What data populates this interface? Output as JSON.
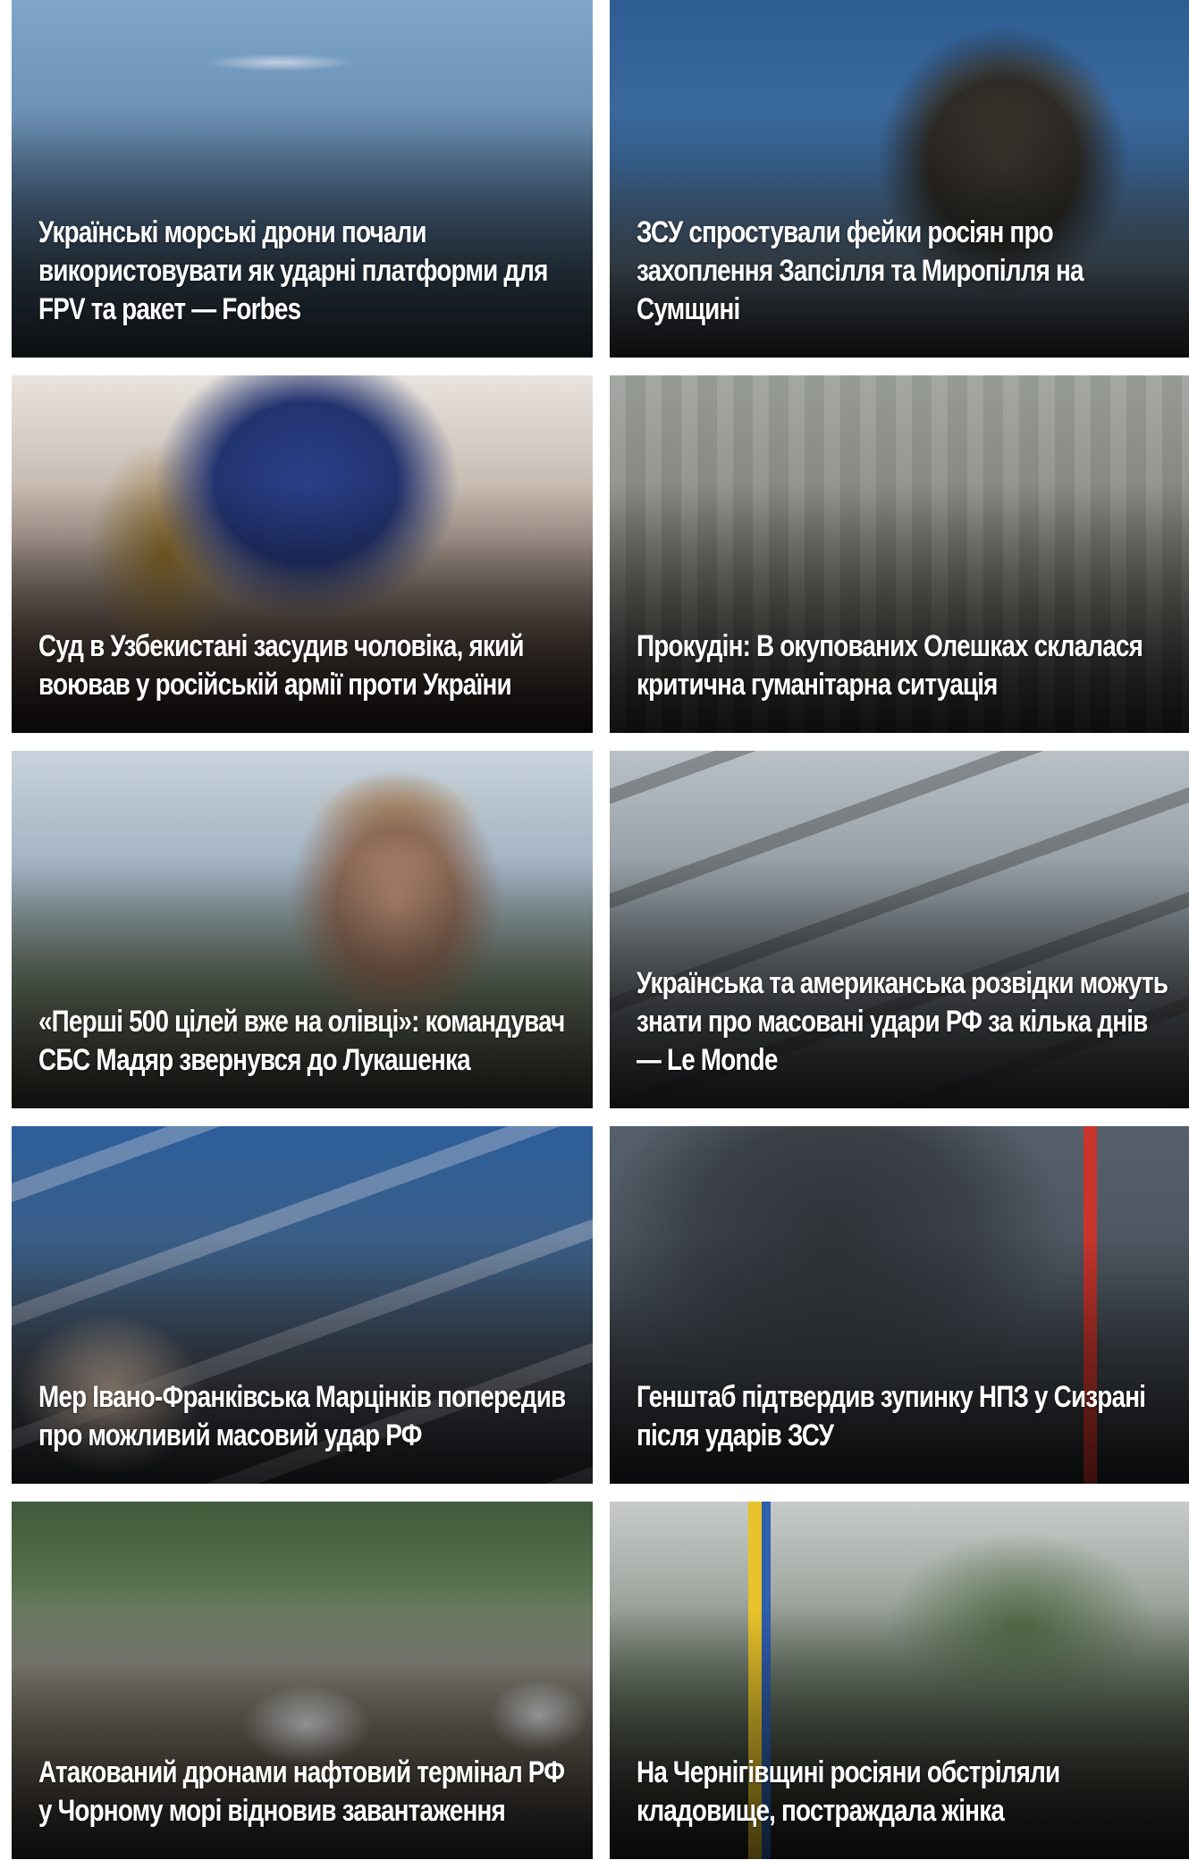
{
  "news_grid": {
    "cards": [
      {
        "title": "Українські морські дрони почали використовувати як ударні платформи для FPV та ракет — Forbes",
        "image": "naval-drone-missile-launch"
      },
      {
        "title": "ЗСУ спростували фейки росіян про захоплення Запсілля та Миропілля на Сумщині",
        "image": "soldier-with-ukrainian-flag"
      },
      {
        "title": "Суд в Узбекистані засудив чоловіка, який воював у російській армії проти України",
        "image": "court-scales-and-gavel"
      },
      {
        "title": "Прокудін: В окупованих Олешках склалася критична гуманітарна ситуація",
        "image": "aerial-town-view"
      },
      {
        "title": "«Перші 500 цілей вже на олівці»: командувач СБС Мадяр звернувся до Лукашенка",
        "image": "bearded-man-in-cap"
      },
      {
        "title": "Українська та американська розвідки можуть знати про масовані удари РФ за кілька днів — Le Monde",
        "image": "missiles-and-bombs"
      },
      {
        "title": "Мер Івано-Франківська Марцінків попередив про можливий масовий удар РФ",
        "image": "rocket-launch-missiles"
      },
      {
        "title": "Генштаб підтвердив зупинку НПЗ у Сизрані після ударів ЗСУ",
        "image": "refinery-smoke"
      },
      {
        "title": "Атакований дронами нафтовий термінал РФ у Чорному морі відновив завантаження",
        "image": "oil-terminal-tanks"
      },
      {
        "title": "На Чернігівщині росіяни обстріляли кладовище, постраждала жінка",
        "image": "cemetery-with-flags"
      }
    ]
  }
}
